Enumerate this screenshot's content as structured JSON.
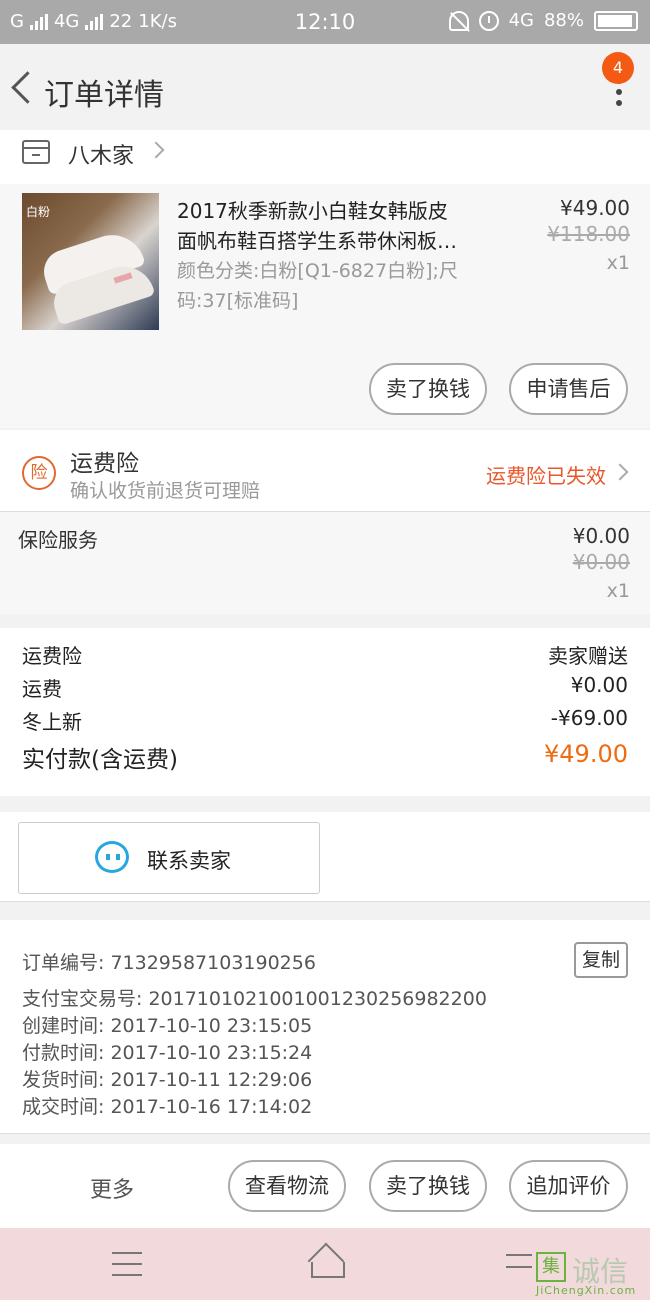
{
  "status_bar": {
    "carrier": "G",
    "network_1": "4G",
    "notif_count": "22",
    "speed": "1K/s",
    "time": "12:10",
    "network_2": "4G",
    "battery": "88%"
  },
  "header": {
    "title": "订单详情",
    "badge_count": "4"
  },
  "shop": {
    "name": "八木家"
  },
  "product": {
    "image_tag": "白粉",
    "title_line1": "2017秋季新款小白鞋女韩版皮",
    "title_line2": "面帆布鞋百搭学生系带休闲板…",
    "sku": "颜色分类:白粉[Q1-6827白粉];尺码:37[标准码]",
    "price": "¥49.00",
    "original_price": "¥118.00",
    "quantity": "x1",
    "buttons": {
      "sell": "卖了换钱",
      "after_sale": "申请售后"
    }
  },
  "freight_insurance": {
    "icon_label": "险",
    "title": "运费险",
    "subtitle": "确认收货前退货可理赔",
    "status": "运费险已失效"
  },
  "service": {
    "name": "保险服务",
    "price": "¥0.00",
    "original_price": "¥0.00",
    "quantity": "x1"
  },
  "summary": {
    "rows": [
      {
        "label": "运费险",
        "value": "卖家赠送"
      },
      {
        "label": "运费",
        "value": "¥0.00"
      },
      {
        "label": "冬上新",
        "value": "-¥69.00"
      }
    ],
    "total_label": "实付款(含运费)",
    "total_value": "¥49.00"
  },
  "contact": {
    "label": "联系卖家"
  },
  "order_info": {
    "order_no": "订单编号: 71329587103190256",
    "alipay_no": "支付宝交易号: 2017101021001001230256982200",
    "created": "创建时间: 2017-10-10  23:15:05",
    "paid": "付款时间: 2017-10-10  23:15:24",
    "shipped": "发货时间: 2017-10-11  12:29:06",
    "completed": "成交时间: 2017-10-16  17:14:02",
    "copy_label": "复制"
  },
  "actions": {
    "more": "更多",
    "logistics": "查看物流",
    "sell": "卖了换钱",
    "review": "追加评价"
  },
  "watermark": {
    "logo": "集",
    "text": "诚信",
    "url": "JiChengXin.com"
  },
  "colors": {
    "accent_orange": "#f26a10",
    "warning_red": "#e8562a",
    "chat_blue": "#29a6e0"
  }
}
